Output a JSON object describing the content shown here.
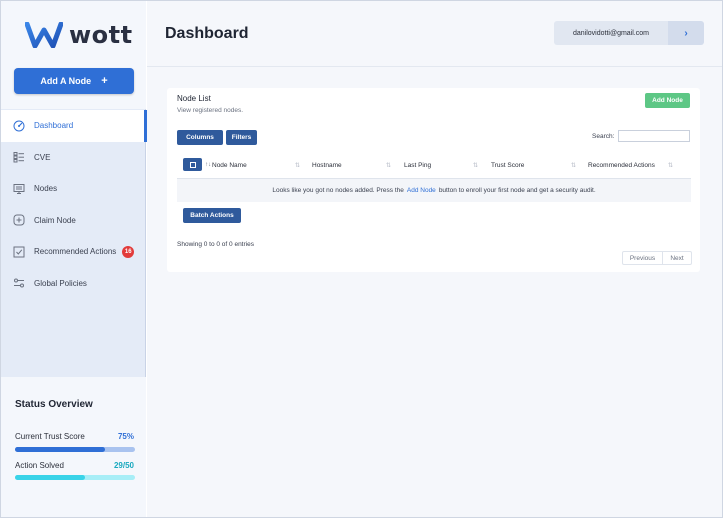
{
  "app": {
    "logo_text": "wott"
  },
  "sidebar": {
    "add_node_label": "Add A Node",
    "add_node_plus": "+",
    "items": [
      {
        "label": "Dashboard",
        "icon": "gauge-icon",
        "active": true
      },
      {
        "label": "CVE",
        "icon": "list-icon"
      },
      {
        "label": "Nodes",
        "icon": "monitor-icon"
      },
      {
        "label": "Claim Node",
        "icon": "plus-square-icon"
      },
      {
        "label": "Recommended Actions",
        "icon": "check-square-icon",
        "badge": "16"
      },
      {
        "label": "Global Policies",
        "icon": "sliders-icon"
      }
    ],
    "status": {
      "title": "Status Overview",
      "trust_label": "Current Trust Score",
      "trust_value": "75%",
      "trust_fraction": 0.75,
      "actions_label": "Action Solved",
      "actions_value": "29/50",
      "actions_fraction": 0.58
    }
  },
  "header": {
    "title": "Dashboard",
    "user_email": "danilovidotti@gmail.com",
    "user_arrow": "›"
  },
  "node_list": {
    "title": "Node List",
    "subtitle": "View registered nodes.",
    "add_button": "Add Node",
    "columns_button": "Columns",
    "filters_button": "Filters",
    "search_label": "Search:",
    "search_value": "",
    "sort_first": "↑↓",
    "sort_glyph": "⇅",
    "headers": [
      "Node Name",
      "Hostname",
      "Last Ping",
      "Trust Score",
      "Recommended Actions"
    ],
    "empty_prefix": "Looks like you got no nodes added. Press the",
    "empty_link": "Add Node",
    "empty_suffix": "button to enroll your first node and get a security audit.",
    "batch_button": "Batch Actions",
    "showing": "Showing 0 to 0 of 0 entries",
    "prev": "Previous",
    "next": "Next"
  },
  "colors": {
    "brand": "#2f6fd6",
    "add_node_green": "#5dc785",
    "trust_bar": "#2f6fd6",
    "trust_bar_bg": "#a9c3ef",
    "actions_bar": "#39d3e8",
    "actions_bar_bg": "#a7eef7",
    "badge_red": "#e23b3b"
  }
}
